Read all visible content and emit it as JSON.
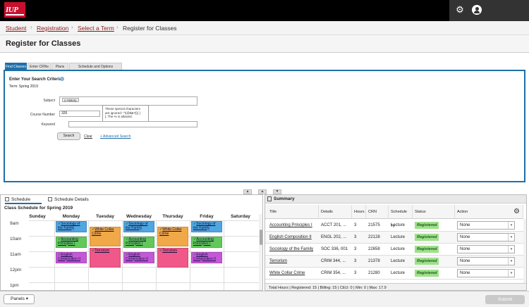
{
  "brand": {
    "logo_text": "IUP"
  },
  "header": {
    "gear_icon": "gear-icon",
    "user_icon": "user-icon"
  },
  "breadcrumb": [
    {
      "label": "Student"
    },
    {
      "label": "Registration"
    },
    {
      "label": "Select a Term"
    },
    {
      "label": "Register for Classes"
    }
  ],
  "page": {
    "title": "Register for Classes"
  },
  "tabs": [
    {
      "label": "Find Classes",
      "active": true
    },
    {
      "label": "Enter CRNs",
      "active": false
    },
    {
      "label": "Plans",
      "active": false
    },
    {
      "label": "Schedule and Options",
      "active": false
    }
  ],
  "search": {
    "criteria_title": "Enter Your Search Criteria",
    "term_label": "Term: Spring 2019",
    "subject_label": "Subject",
    "subject_chip": "x History",
    "course_number_label": "Course Number",
    "course_number_value": "326",
    "keyword_label": "Keyword",
    "tooltip_line1": "These special characters",
    "tooltip_line2": "are ignored: \"'\\(@$&?|}{ )",
    "tooltip_line3": "[. The % is allowed.",
    "search_button": "Search",
    "clear_link": "Clear",
    "advanced_link": "+ Advanced Search"
  },
  "schedule": {
    "tab_schedule": "Schedule",
    "tab_details": "Schedule Details",
    "title": "Class Schedule for Spring 2019",
    "days": [
      "Sunday",
      "Monday",
      "Tuesday",
      "Wednesday",
      "Thursday",
      "Friday",
      "Saturday"
    ],
    "times": [
      "9am",
      "10am",
      "11am",
      "12pm",
      "1pm"
    ],
    "events": [
      {
        "id": "mon-soc",
        "check": "✓",
        "name": "Sociology of the Family",
        "color": "#4fa6e0"
      },
      {
        "id": "tue-wcc",
        "check": "✓",
        "name": "White Collar Crime",
        "color": "#f0a848"
      },
      {
        "id": "wed-soc",
        "check": "✓",
        "name": "Sociology of the Family",
        "color": "#4fa6e0"
      },
      {
        "id": "thu-wcc",
        "check": "✓",
        "name": "White Collar Crime",
        "color": "#f0a848"
      },
      {
        "id": "fri-soc",
        "check": "✓",
        "name": "Sociology of the Family",
        "color": "#4fa6e0"
      },
      {
        "id": "mon-acc",
        "check": "✓",
        "name": "Accounting Principles I",
        "color": "#62c85a"
      },
      {
        "id": "wed-acc",
        "check": "✓",
        "name": "Accounting Principles I",
        "color": "#62c85a"
      },
      {
        "id": "fri-acc",
        "check": "✓",
        "name": "Accounting Principles I",
        "color": "#62c85a"
      },
      {
        "id": "tue-ter",
        "check": "✓",
        "name": "Terrorism",
        "color": "#f0588a"
      },
      {
        "id": "thu-ter",
        "check": "✓",
        "name": "Terrorism",
        "color": "#f0588a"
      },
      {
        "id": "mon-eng",
        "check": "✓",
        "name": "English Composition II",
        "color": "#c458d8"
      },
      {
        "id": "wed-eng",
        "check": "✓",
        "name": "English Composition II",
        "color": "#c458d8"
      },
      {
        "id": "fri-eng",
        "check": "✓",
        "name": "English Composition II",
        "color": "#c458d8"
      }
    ]
  },
  "summary": {
    "title": "Summary",
    "columns": [
      "Title",
      "Details",
      "Hours",
      "CRN",
      "Schedule Ty",
      "Status",
      "Action"
    ],
    "rows": [
      {
        "title": "Accounting Principles I",
        "details": "ACCT 201, ...",
        "hours": "3",
        "crn": "21575",
        "type": "Lecture",
        "status": "Registered",
        "action": "None"
      },
      {
        "title": "English Composition II",
        "details": "ENGL 202, ...",
        "hours": "3",
        "crn": "22128",
        "type": "Lecture",
        "status": "Registered",
        "action": "None"
      },
      {
        "title": "Sociology of the Family",
        "details": "SOC 336, 001",
        "hours": "3",
        "crn": "22658",
        "type": "Lecture",
        "status": "Registered",
        "action": "None"
      },
      {
        "title": "Terrorism",
        "details": "CRIM 344, ...",
        "hours": "3",
        "crn": "21378",
        "type": "Lecture",
        "status": "Registered",
        "action": "None"
      },
      {
        "title": "White Collar Crime",
        "details": "CRIM 354, ...",
        "hours": "3",
        "crn": "21280",
        "type": "Lecture",
        "status": "Registered",
        "action": "None"
      }
    ],
    "totals": "Total Hours | Registered: 15 | Billing: 15 | CEU: 0 | Min: 0 | Max: 17.9"
  },
  "footer": {
    "panels_button": "Panels",
    "submit_button": "Submit"
  }
}
